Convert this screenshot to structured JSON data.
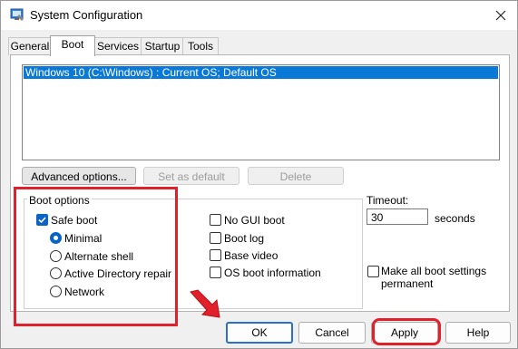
{
  "window": {
    "title": "System Configuration"
  },
  "tabs": [
    {
      "label": "General"
    },
    {
      "label": "Boot"
    },
    {
      "label": "Services"
    },
    {
      "label": "Startup"
    },
    {
      "label": "Tools"
    }
  ],
  "os_list": {
    "entries": [
      "Windows 10 (C:\\Windows) : Current OS; Default OS"
    ]
  },
  "actions": {
    "advanced_options": "Advanced options...",
    "set_as_default": "Set as default",
    "delete": "Delete"
  },
  "boot_options": {
    "label": "Boot options",
    "safe_boot": {
      "label": "Safe boot",
      "checked": true
    },
    "modes": [
      {
        "label": "Minimal",
        "selected": true
      },
      {
        "label": "Alternate shell",
        "selected": false
      },
      {
        "label": "Active Directory repair",
        "selected": false
      },
      {
        "label": "Network",
        "selected": false
      }
    ],
    "flags": [
      {
        "label": "No GUI boot",
        "checked": false
      },
      {
        "label": "Boot log",
        "checked": false
      },
      {
        "label": "Base video",
        "checked": false
      },
      {
        "label": "OS boot information",
        "checked": false
      }
    ]
  },
  "timeout": {
    "label": "Timeout:",
    "value": "30",
    "unit": "seconds"
  },
  "permanent": {
    "label_line1": "Make all boot settings",
    "label_line2": "permanent",
    "checked": false
  },
  "footer": {
    "ok": "OK",
    "cancel": "Cancel",
    "apply": "Apply",
    "help": "Help"
  },
  "colors": {
    "accent": "#0a64c8",
    "selection": "#0a78d7",
    "highlight_red": "#e0202a"
  }
}
